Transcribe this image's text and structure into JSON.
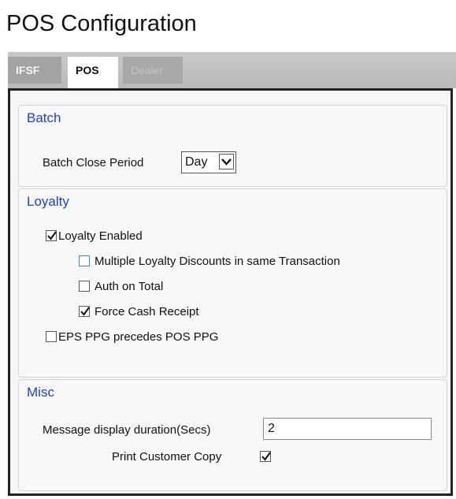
{
  "page": {
    "title": "POS Configuration"
  },
  "tabs": [
    {
      "label": "IFSF",
      "active": false
    },
    {
      "label": "POS",
      "active": true
    },
    {
      "label": "Dealer",
      "active": false,
      "disabled": true
    }
  ],
  "batch": {
    "legend": "Batch",
    "close_period_label": "Batch Close Period",
    "close_period_value": "Day"
  },
  "loyalty": {
    "legend": "Loyalty",
    "loyalty_enabled": {
      "label": "Loyalty Enabled",
      "checked": true
    },
    "multiple_discounts": {
      "label": "Multiple Loyalty Discounts in same Transaction",
      "checked": false
    },
    "auth_on_total": {
      "label": "Auth on Total",
      "checked": false
    },
    "force_cash_receipt": {
      "label": "Force Cash Receipt",
      "checked": true
    },
    "eps_ppg": {
      "label": "EPS PPG precedes POS PPG",
      "checked": false
    }
  },
  "misc": {
    "legend": "Misc",
    "message_duration_label": "Message display duration(Secs)",
    "message_duration_value": "2",
    "print_customer_copy": {
      "label": "Print Customer Copy",
      "checked": true
    }
  },
  "colors": {
    "legend": "#1c3fd1",
    "tab_bar": "#bcbcbc",
    "panel_border": "#222222"
  }
}
